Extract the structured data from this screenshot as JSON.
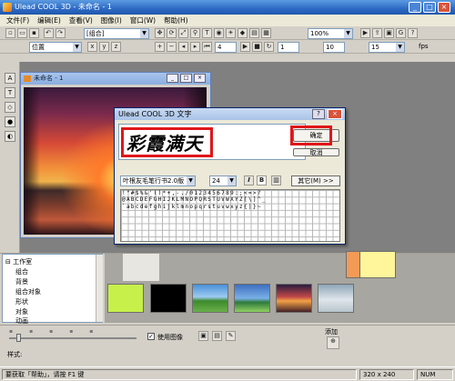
{
  "window": {
    "title": "Ulead COOL 3D - 未命名 - 1"
  },
  "menu": [
    "文件(F)",
    "编辑(E)",
    "查看(V)",
    "图像(I)",
    "窗口(W)",
    "帮助(H)"
  ],
  "toolbar1": {
    "combo_object": "[组合]",
    "combo_zoom": "100%"
  },
  "toolbar2": {
    "combo_position": "位置",
    "field_a": "4",
    "field_b": "1",
    "field_c": "10",
    "field_d": "15",
    "fps_label": "fps"
  },
  "child_window": {
    "title": "未命名 - 1"
  },
  "dialog": {
    "title": "Ulead COOL 3D 文字",
    "typed_text": "彩霞满天",
    "ok_label": "确定",
    "cancel_label": "取消",
    "font_name": "叶根友毛笔行书2.0版",
    "font_size": "24",
    "italic_label": "I",
    "bold_label": "B",
    "other_label": "其它(M) >>",
    "grid_rows": [
      " !\"#$%&'()*+,-./0123456789:;<=>?",
      "@ABCDEFGHIJKLMNOPQRSTUVWXYZ[\\]^_",
      "`abcdefghijklmnopqrstuvwxyz{|}~"
    ]
  },
  "tree": {
    "root": "工作室",
    "items": [
      "组合",
      "背景",
      "组合对象",
      "形状",
      "对象",
      "动画"
    ]
  },
  "props": {
    "use_image_label": "使用图像",
    "add_label": "添加",
    "style_label": "样式:"
  },
  "status": {
    "hint": "要获取「帮助」，请按 F1 键",
    "size": "320 x 240",
    "num": "NUM"
  },
  "colors": {
    "red_highlight": "#e0161b",
    "titlebar": "#2d6ac4"
  }
}
